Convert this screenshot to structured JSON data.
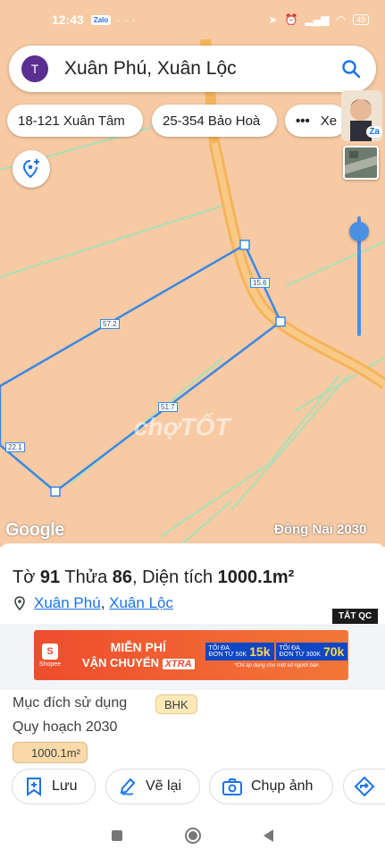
{
  "status": {
    "time": "12:43",
    "zalo": "Zalo",
    "battery": "49"
  },
  "search": {
    "avatar_letter": "T",
    "query": "Xuân Phú, Xuân Lộc"
  },
  "chips": [
    "18-121 Xuân Tâm",
    "25-354 Bảo Hoà",
    "Xe"
  ],
  "profile_badge": "Za",
  "map": {
    "segment_lengths": [
      "15.6",
      "57.2",
      "51.7",
      "22.1"
    ],
    "provider": "Google",
    "overlay_name": "Đồng Nai 2030",
    "watermark": "chợTỐT"
  },
  "lot": {
    "sheet_label": "Tờ",
    "sheet_no": "91",
    "parcel_label": "Thửa",
    "parcel_no": "86",
    "area_label": "Diện tích",
    "area_value": "1000.1m²",
    "ward": "Xuân Phú",
    "district": "Xuân Lộc"
  },
  "ad": {
    "close_label": "TẮT QC",
    "brand": "Shopee",
    "line1": "MIỄN PHÍ",
    "line2": "VẬN CHUYỂN",
    "badge": "XTRA",
    "vouchers": [
      {
        "prefix": "TỐI ĐA",
        "amount": "15k",
        "sub": "ĐƠN TỪ 50K"
      },
      {
        "prefix": "TỐI ĐA",
        "amount": "70k",
        "sub": "ĐƠN TỪ 300K"
      }
    ],
    "note": "*Chỉ áp dụng cho một số người bán"
  },
  "details": {
    "purpose_label": "Mục đích sử dụng",
    "purpose_value": "BHK",
    "plan_label": "Quy hoạch 2030",
    "area_badge": "1000.1m²"
  },
  "actions": {
    "save": "Lưu",
    "redraw": "Vẽ lại",
    "capture": "Chụp ảnh"
  },
  "colors": {
    "accent": "#1a73e8",
    "map_bg": "#f7caa3",
    "road": "#f5b45b",
    "parcel": "#3a87e6",
    "grid": "#9fe3b9"
  }
}
